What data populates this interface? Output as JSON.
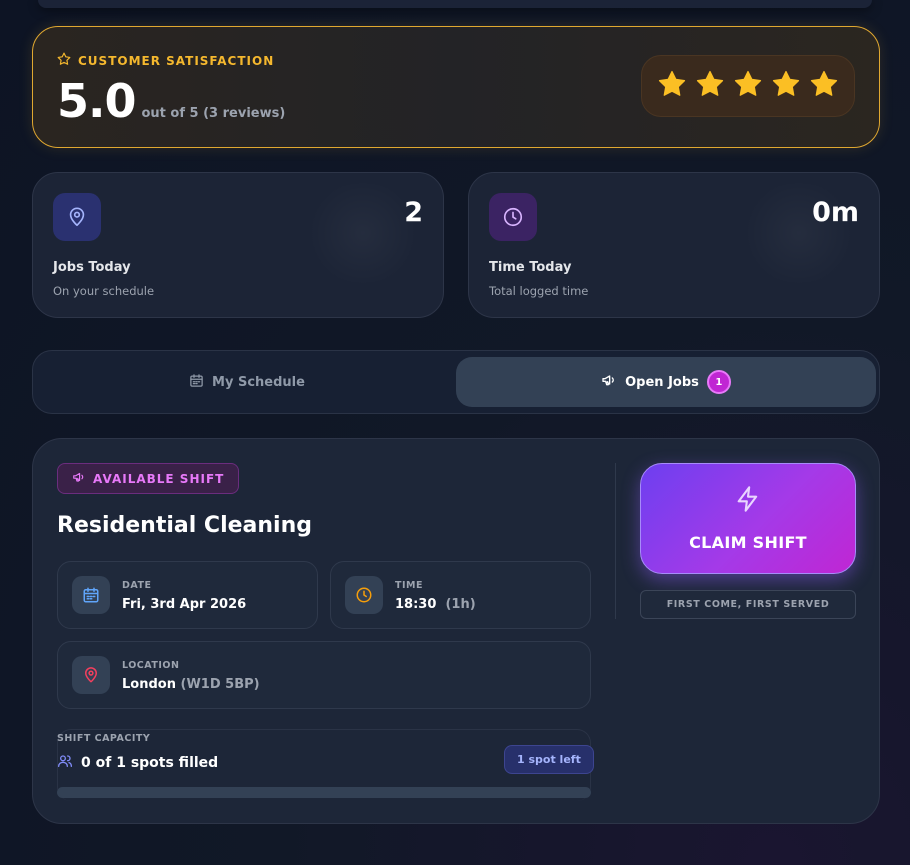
{
  "rating": {
    "label": "CUSTOMER SATISFACTION",
    "value": "5.0",
    "subtext": "out of 5 (3 reviews)",
    "stars": 5,
    "star_color": "#fbbf24"
  },
  "stats": [
    {
      "title": "Jobs Today",
      "subtitle": "On your schedule",
      "value": "2",
      "icon": "map-pin-icon",
      "accent": "#6366f1"
    },
    {
      "title": "Time Today",
      "subtitle": "Total logged time",
      "value": "0m",
      "icon": "clock-icon",
      "accent": "#a855f7"
    }
  ],
  "tabs": {
    "schedule_label": "My Schedule",
    "open_label": "Open Jobs",
    "open_count": "1",
    "active": "open"
  },
  "job": {
    "badge": "AVAILABLE SHIFT",
    "title": "Residential Cleaning",
    "date_label": "DATE",
    "date_value": "Fri, 3rd Apr 2026",
    "time_label": "TIME",
    "time_value": "18:30",
    "time_duration": "(1h)",
    "location_label": "LOCATION",
    "location_city": "London",
    "location_postcode": "(W1D 5BP)",
    "capacity_label": "SHIFT CAPACITY",
    "capacity_text": "0 of 1 spots filled",
    "spots_left": "1 spot left",
    "capacity_fill_fraction": 0,
    "claim_label": "CLAIM SHIFT",
    "claim_note": "FIRST COME, FIRST SERVED"
  }
}
